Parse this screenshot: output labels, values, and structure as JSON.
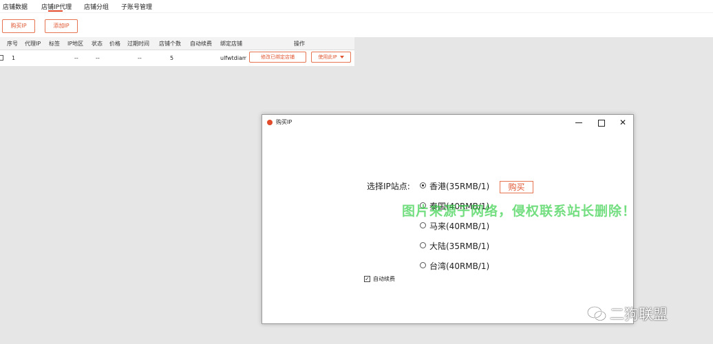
{
  "nav": {
    "tabs": [
      {
        "label": "店铺数据"
      },
      {
        "label": "店铺IP代理"
      },
      {
        "label": "店铺分组"
      },
      {
        "label": "子账号管理"
      }
    ],
    "active_tab": "店铺IP代理"
  },
  "toolbar": {
    "buy_ip_label": "购买IP",
    "add_ip_label": "添加IP"
  },
  "table": {
    "headers": [
      "序号",
      "代理IP",
      "标签",
      "IP地区",
      "状态",
      "价格",
      "过期时间",
      "店铺个数",
      "自动续费",
      "绑定店铺",
      "操作"
    ],
    "rows": [
      {
        "index": "1",
        "proxy_ip": "",
        "tag": "",
        "region": "--",
        "status": "--",
        "price": "",
        "expire": "--",
        "shop_count": "5",
        "auto_renew": "",
        "bound_shop": "ulfwtdiam",
        "edit_action": "修改已绑定店铺",
        "use_action": "使用此IP"
      }
    ]
  },
  "dialog": {
    "title": "购买IP",
    "site_label": "选择IP站点:",
    "options": [
      {
        "label": "香港(35RMB/1)",
        "checked": true
      },
      {
        "label": "泰国(40RMB/1)",
        "checked": false
      },
      {
        "label": "马来(40RMB/1)",
        "checked": false
      },
      {
        "label": "大陆(35RMB/1)",
        "checked": false
      },
      {
        "label": "台湾(40RMB/1)",
        "checked": false
      }
    ],
    "buy_label": "购买",
    "auto_renew_label": "自动续费",
    "auto_renew_checked": true,
    "close_glyph": "✕"
  },
  "overlay": {
    "watermark": "图片来源于网络，侵权联系站长删除！",
    "brand": "二狗联盟"
  },
  "colors": {
    "accent": "#e0552f",
    "watermark": "#28cd3c"
  }
}
